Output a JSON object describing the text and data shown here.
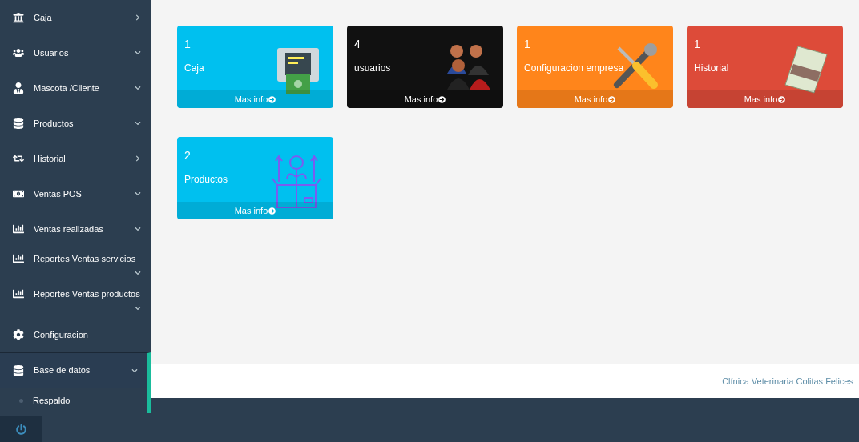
{
  "sidebar": {
    "items": [
      {
        "label": "Caja",
        "expanded": false,
        "selected": false
      },
      {
        "label": "Usuarios",
        "expanded": true,
        "selected": false
      },
      {
        "label": "Mascota /Cliente",
        "expanded": true,
        "selected": false
      },
      {
        "label": "Productos",
        "expanded": true,
        "selected": false
      },
      {
        "label": "Historial",
        "expanded": false,
        "selected": false
      },
      {
        "label": "Ventas POS",
        "expanded": true,
        "selected": false
      },
      {
        "label": "Ventas realizadas",
        "expanded": true,
        "selected": false
      },
      {
        "label": "Reportes Ventas servicios",
        "expanded": true,
        "selected": false
      },
      {
        "label": "Reportes Ventas productos",
        "expanded": true,
        "selected": false
      },
      {
        "label": "Configuracion",
        "selected": false
      },
      {
        "label": "Base de datos",
        "expanded": true,
        "selected": true,
        "children": [
          {
            "label": "Respaldo"
          }
        ]
      }
    ]
  },
  "cards": [
    {
      "count": "1",
      "label": "Caja",
      "link": "Mas info",
      "color": "#00c0ef"
    },
    {
      "count": "4",
      "label": "usuarios",
      "link": "Mas info",
      "color": "#111111"
    },
    {
      "count": "1",
      "label": "Configuracion empresa",
      "link": "Mas info",
      "color": "#ff851b"
    },
    {
      "count": "1",
      "label": "Historial",
      "link": "Mas info",
      "color": "#dd4b39"
    },
    {
      "count": "2",
      "label": "Productos",
      "link": "Mas info",
      "color": "#00c0ef"
    }
  ],
  "footer": {
    "text": "Clínica Veterinaria Colitas Felices"
  }
}
